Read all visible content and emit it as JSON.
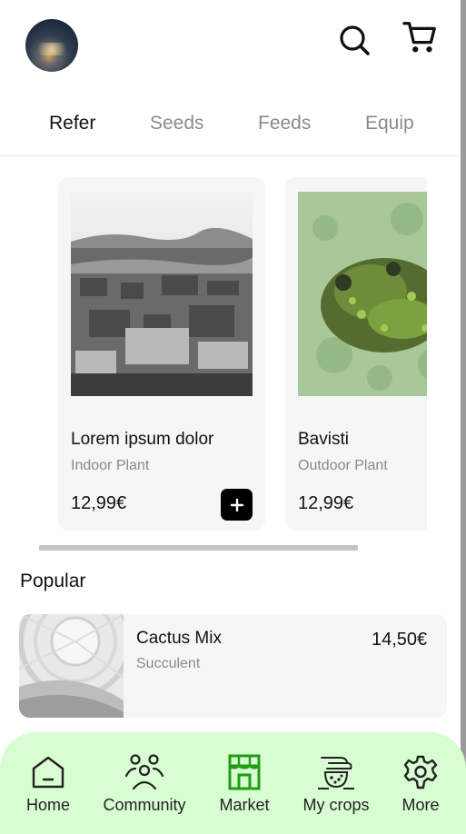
{
  "header": {
    "avatar_icon": "user-avatar",
    "search_icon": "search-icon",
    "cart_icon": "cart-icon"
  },
  "tabs": [
    {
      "label": "Refer",
      "active": true
    },
    {
      "label": "Seeds",
      "active": false
    },
    {
      "label": "Feeds",
      "active": false
    },
    {
      "label": "Equip",
      "active": false
    }
  ],
  "products": [
    {
      "title": "Lorem ipsum dolor",
      "subtitle": "Indoor Plant",
      "price": "12,99€"
    },
    {
      "title": "Bavisti",
      "subtitle": "Outdoor Plant",
      "price": "12,99€"
    }
  ],
  "popular": {
    "title": "Popular",
    "items": [
      {
        "title": "Cactus Mix",
        "subtitle": "Succulent",
        "price": "14,50€"
      }
    ]
  },
  "nav": {
    "items": [
      {
        "label": "Home",
        "icon": "home-icon",
        "active": false
      },
      {
        "label": "Community",
        "icon": "community-icon",
        "active": false
      },
      {
        "label": "Market",
        "icon": "market-icon",
        "active": true
      },
      {
        "label": "My crops",
        "icon": "crops-icon",
        "active": false
      },
      {
        "label": "More",
        "icon": "gear-icon",
        "active": false
      }
    ],
    "active_color": "#1f9e12",
    "background": "#d9fdd3"
  }
}
